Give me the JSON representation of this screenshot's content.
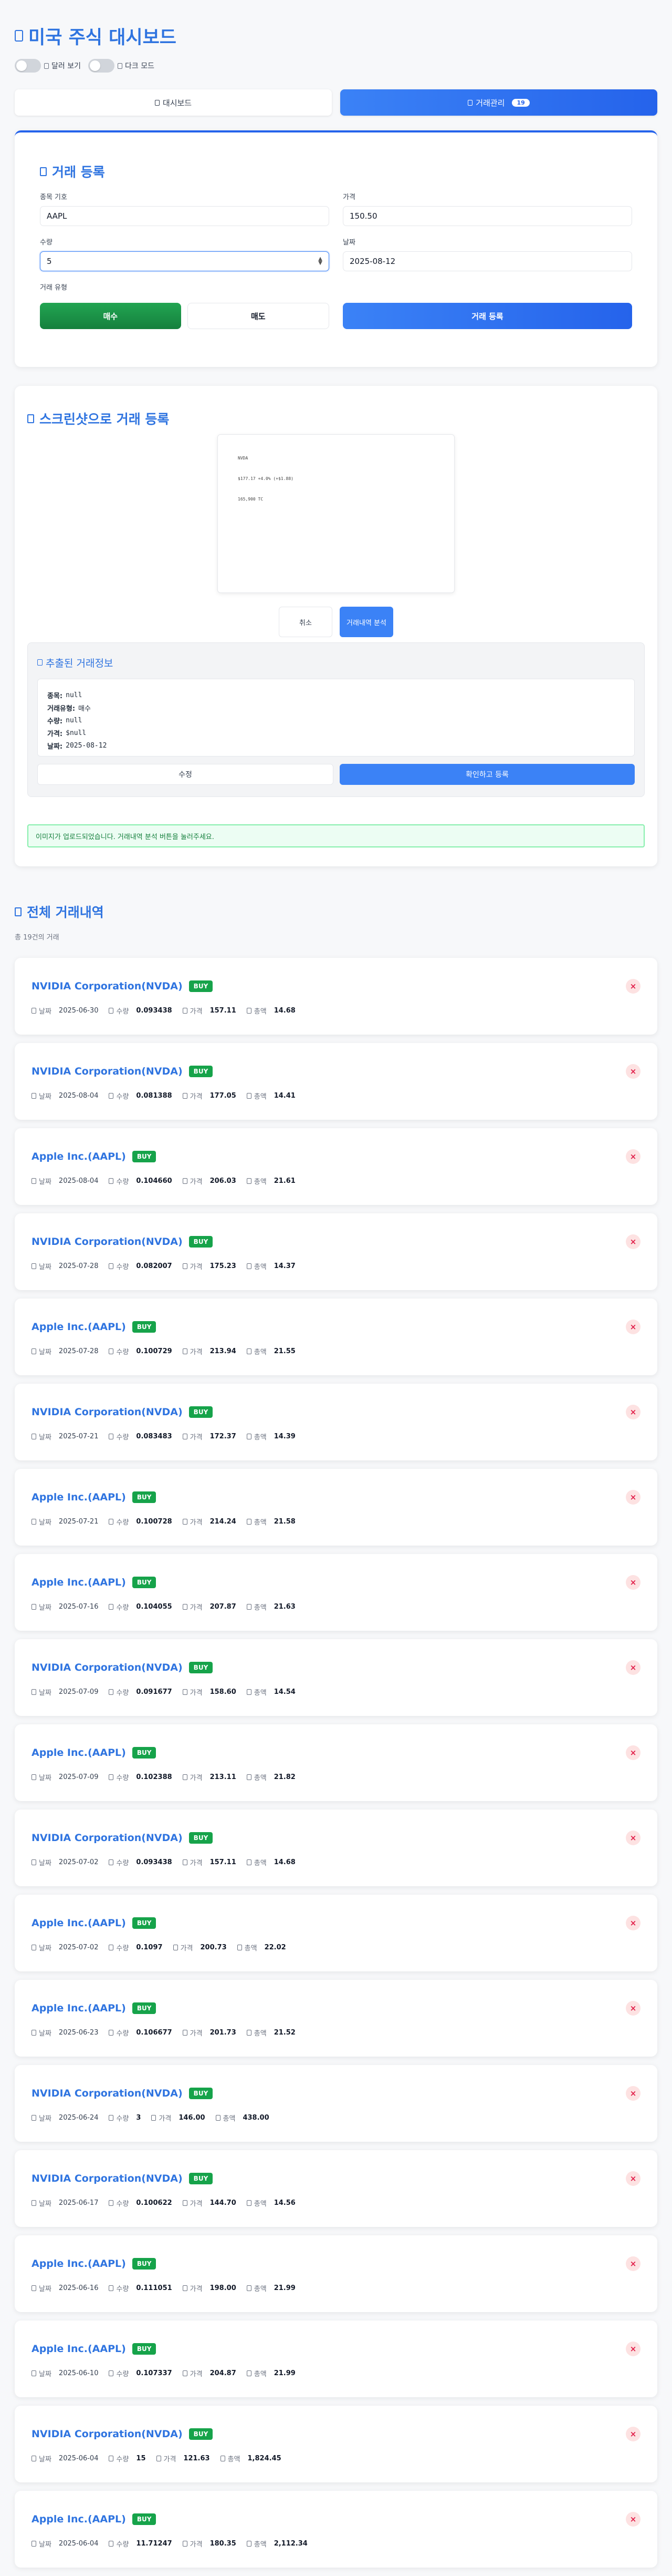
{
  "header": {
    "title": "미국 주식 대시보드",
    "dollar_toggle_label": "달러 보기",
    "dark_toggle_label": "다크 모드"
  },
  "tabs": [
    {
      "label": "대시보드"
    },
    {
      "label": "거래관리",
      "badge": "19"
    }
  ],
  "register": {
    "title": "거래 등록",
    "ticker_label": "종목 기호",
    "ticker_value": "AAPL",
    "price_label": "가격",
    "price_value": "150.50",
    "qty_label": "수량",
    "qty_value": "5",
    "date_label": "날짜",
    "date_value": "2025-08-12",
    "type_label": "거래 유형",
    "buy_label": "매수",
    "sell_label": "매도",
    "submit_label": "거래 등록"
  },
  "screenshot": {
    "title": "스크린샷으로 거래 등록",
    "preview_lines": [
      "NVDA",
      "$177.17 +4.0% (+$1.88)",
      "165,900 TC"
    ],
    "cancel_label": "취소",
    "analyze_label": "거래내역 분석",
    "extract_title": "추출된 거래정보",
    "extract_rows": [
      {
        "key": "종목:",
        "value": "null"
      },
      {
        "key": "거래유형:",
        "value": "매수"
      },
      {
        "key": "수량:",
        "value": "null"
      },
      {
        "key": "가격:",
        "value": "$null"
      },
      {
        "key": "날짜:",
        "value": "2025-08-12"
      }
    ],
    "edit_label": "수정",
    "confirm_label": "확인하고 등록",
    "notice": "이미지가 업로드되었습니다. 거래내역 분석 버튼을 눌러주세요."
  },
  "history": {
    "title": "전체 거래내역",
    "count": "총 19건의 거래",
    "labels": {
      "date": "날짜",
      "qty": "수량",
      "price": "가격",
      "total": "총액"
    },
    "delete_label": "×",
    "transactions": [
      {
        "name": "NVIDIA Corporation(NVDA)",
        "type": "BUY",
        "date": "2025-06-30",
        "qty": "0.093438",
        "price": "157.11",
        "total": "14.68"
      },
      {
        "name": "NVIDIA Corporation(NVDA)",
        "type": "BUY",
        "date": "2025-08-04",
        "qty": "0.081388",
        "price": "177.05",
        "total": "14.41"
      },
      {
        "name": "Apple Inc.(AAPL)",
        "type": "BUY",
        "date": "2025-08-04",
        "qty": "0.104660",
        "price": "206.03",
        "total": "21.61"
      },
      {
        "name": "NVIDIA Corporation(NVDA)",
        "type": "BUY",
        "date": "2025-07-28",
        "qty": "0.082007",
        "price": "175.23",
        "total": "14.37"
      },
      {
        "name": "Apple Inc.(AAPL)",
        "type": "BUY",
        "date": "2025-07-28",
        "qty": "0.100729",
        "price": "213.94",
        "total": "21.55"
      },
      {
        "name": "NVIDIA Corporation(NVDA)",
        "type": "BUY",
        "date": "2025-07-21",
        "qty": "0.083483",
        "price": "172.37",
        "total": "14.39"
      },
      {
        "name": "Apple Inc.(AAPL)",
        "type": "BUY",
        "date": "2025-07-21",
        "qty": "0.100728",
        "price": "214.24",
        "total": "21.58"
      },
      {
        "name": "Apple Inc.(AAPL)",
        "type": "BUY",
        "date": "2025-07-16",
        "qty": "0.104055",
        "price": "207.87",
        "total": "21.63"
      },
      {
        "name": "NVIDIA Corporation(NVDA)",
        "type": "BUY",
        "date": "2025-07-09",
        "qty": "0.091677",
        "price": "158.60",
        "total": "14.54"
      },
      {
        "name": "Apple Inc.(AAPL)",
        "type": "BUY",
        "date": "2025-07-09",
        "qty": "0.102388",
        "price": "213.11",
        "total": "21.82"
      },
      {
        "name": "NVIDIA Corporation(NVDA)",
        "type": "BUY",
        "date": "2025-07-02",
        "qty": "0.093438",
        "price": "157.11",
        "total": "14.68"
      },
      {
        "name": "Apple Inc.(AAPL)",
        "type": "BUY",
        "date": "2025-07-02",
        "qty": "0.1097",
        "price": "200.73",
        "total": "22.02"
      },
      {
        "name": "Apple Inc.(AAPL)",
        "type": "BUY",
        "date": "2025-06-23",
        "qty": "0.106677",
        "price": "201.73",
        "total": "21.52"
      },
      {
        "name": "NVIDIA Corporation(NVDA)",
        "type": "BUY",
        "date": "2025-06-24",
        "qty": "3",
        "price": "146.00",
        "total": "438.00"
      },
      {
        "name": "NVIDIA Corporation(NVDA)",
        "type": "BUY",
        "date": "2025-06-17",
        "qty": "0.100622",
        "price": "144.70",
        "total": "14.56"
      },
      {
        "name": "Apple Inc.(AAPL)",
        "type": "BUY",
        "date": "2025-06-16",
        "qty": "0.111051",
        "price": "198.00",
        "total": "21.99"
      },
      {
        "name": "Apple Inc.(AAPL)",
        "type": "BUY",
        "date": "2025-06-10",
        "qty": "0.107337",
        "price": "204.87",
        "total": "21.99"
      },
      {
        "name": "NVIDIA Corporation(NVDA)",
        "type": "BUY",
        "date": "2025-06-04",
        "qty": "15",
        "price": "121.63",
        "total": "1,824.45"
      },
      {
        "name": "Apple Inc.(AAPL)",
        "type": "BUY",
        "date": "2025-06-04",
        "qty": "11.71247",
        "price": "180.35",
        "total": "2,112.34"
      }
    ]
  },
  "colors": {
    "accent": "#2563eb",
    "buy": "#16a34a",
    "delete": "#e11d48"
  }
}
